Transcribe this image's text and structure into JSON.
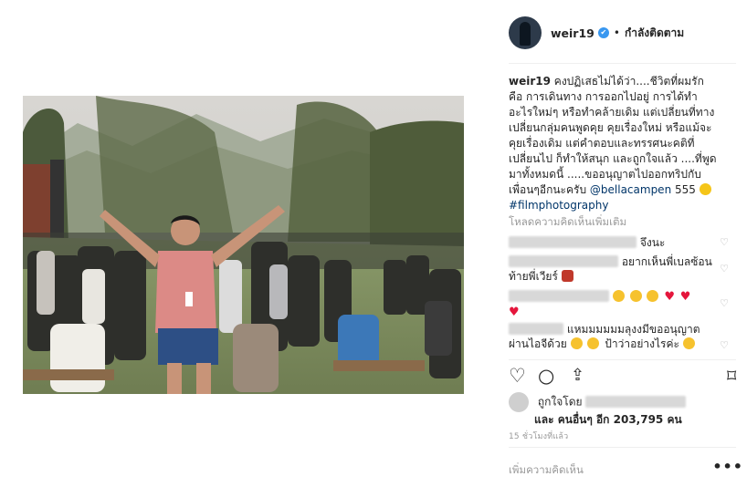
{
  "post": {
    "username": "weir19",
    "verified_mark": "✔",
    "separator": "•",
    "follow_status": "กำลังติดตาม",
    "caption_user": "weir19",
    "caption_text": "คงปฏิเสธไม่ได้ว่า....ชีวิตที่ผมรัก คือ การเดินทาง การออกไปอยู่ การได้ทำอะไรใหม่ๆ หรือทำคล้ายเดิม แต่เปลี่ยนที่ทาง เปลี่ยนกลุ่มคนพูดคุย คุยเรื่องใหม่ หรือแม้จะคุยเรื่องเดิม แต่คำตอบและทรรศนะคติที่เปลี่ยนไป ก็ทำให้สนุก และถูกใจแล้ว ....ที่พูดมาทั้งหมดนี้ .....ขออนุญาตไปออกทริปกับเพื่อนๆอีกนะครับ",
    "mention": "@bellacampen",
    "caption_tail": "555",
    "hashtag": "#filmphotography",
    "load_more": "โหลดความคิดเห็นเพิ่มเติม"
  },
  "comments": [
    {
      "text": "จึงนะ"
    },
    {
      "text": "อยากเห็นพี่เบลซ้อนท้ายพี่เวียร์"
    },
    {
      "text": ""
    },
    {
      "text": "แหมมมมมมลุงงมีขออนุญาตผ่านไอจีด้วย",
      "text2": "ป้าว่าอย่างไรค่ะ"
    }
  ],
  "likes": {
    "liked_by": "ถูกใจโดย",
    "and_others": "และ คนอื่นๆ อีก 203,795 คน"
  },
  "timestamp": "15 ชั่วโมงที่แล้ว",
  "add_comment_placeholder": "เพิ่มความคิดเห็น",
  "more_options": "•••",
  "icons": {
    "like": "heart-icon",
    "comment": "comment-icon",
    "share": "share-icon",
    "save": "bookmark-icon"
  }
}
